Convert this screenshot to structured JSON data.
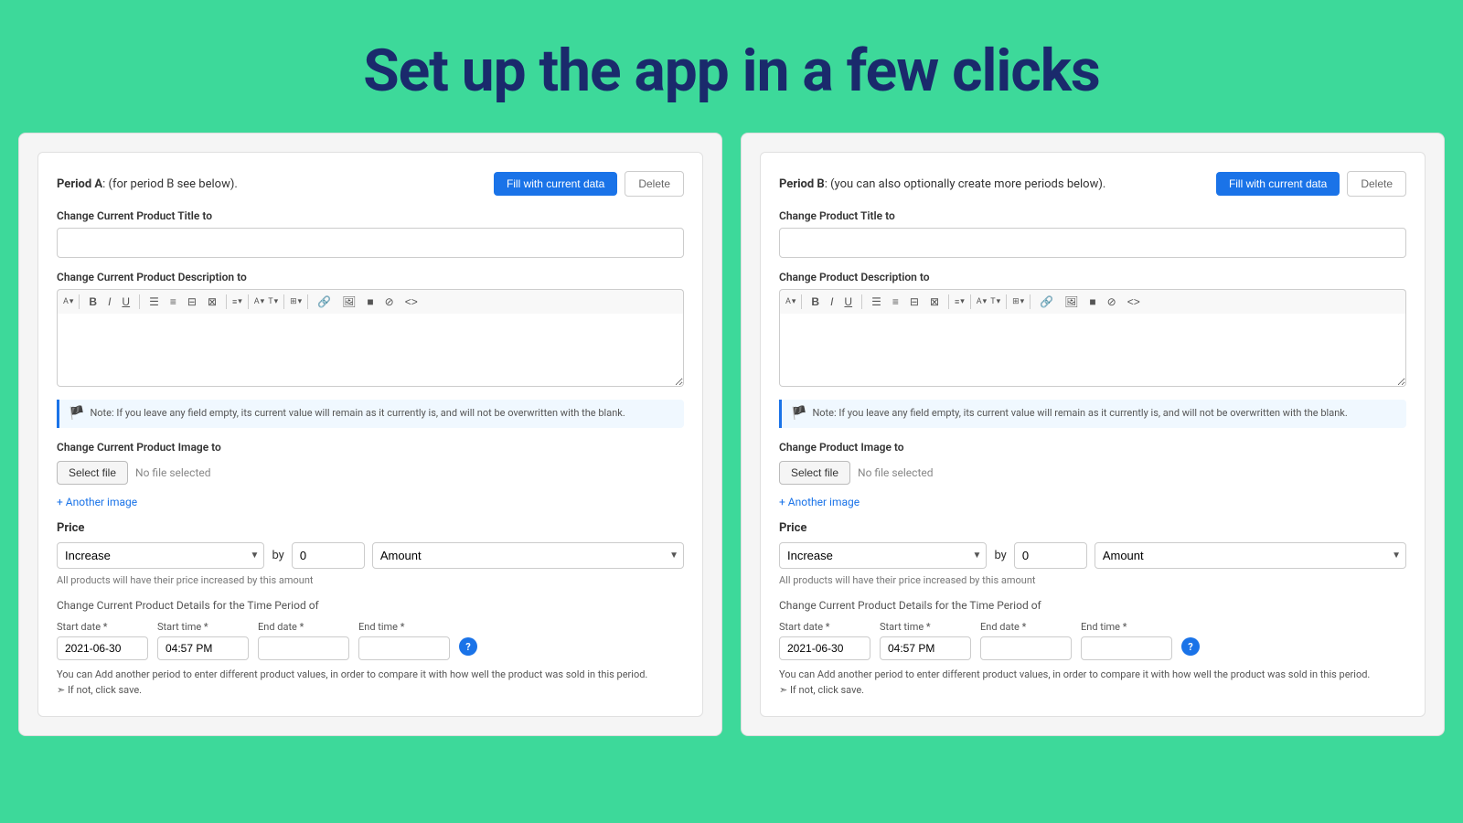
{
  "page": {
    "title": "Set up the app in a few clicks",
    "background_color": "#3dd99a"
  },
  "panel_a": {
    "period_label": "Period A",
    "period_desc": ": (for period B see below).",
    "fill_button": "Fill with current data",
    "delete_button": "Delete",
    "title_label": "Change Current Product Title to",
    "title_placeholder": "",
    "desc_label": "Change Current Product Description to",
    "desc_placeholder": "",
    "note_text": "Note: If you leave any field empty, its current value will remain as it currently is, and will not be overwritten with the blank.",
    "image_label": "Change Current Product Image to",
    "select_file_btn": "Select file",
    "no_file_text": "No file selected",
    "another_image_link": "+ Another image",
    "price_label": "Price",
    "increase_option": "Increase",
    "by_label": "by",
    "price_value": "0",
    "amount_option": "Amount",
    "price_hint": "All products will have their price increased by this amount",
    "time_period_label": "Change Current Product Details for the Time Period of",
    "start_date_label": "Start date *",
    "start_date_value": "2021-06-30",
    "start_time_label": "Start time *",
    "start_time_value": "04:57 PM",
    "end_date_label": "End date *",
    "end_date_value": "",
    "end_time_label": "End time *",
    "end_time_value": "",
    "bottom_note1": "You can Add another period to enter different product values, in order to compare it with how well the product was sold in this period.",
    "bottom_note2": "➣  If not, click save."
  },
  "panel_b": {
    "period_label": "Period B",
    "period_desc": ": (you can also optionally create more periods below).",
    "fill_button": "Fill with current data",
    "delete_button": "Delete",
    "title_label": "Change Product Title to",
    "title_placeholder": "",
    "desc_label": "Change Product Description to",
    "desc_placeholder": "",
    "note_text": "Note: If you leave any field empty, its current value will remain as it currently is, and will not be overwritten with the blank.",
    "image_label": "Change Product Image to",
    "select_file_btn": "Select file",
    "no_file_text": "No file selected",
    "another_image_link": "+ Another image",
    "price_label": "Price",
    "increase_option": "Increase",
    "by_label": "by",
    "price_value": "0",
    "amount_option": "Amount",
    "price_hint": "All products will have their price increased by this amount",
    "time_period_label": "Change Current Product Details for the Time Period of",
    "start_date_label": "Start date *",
    "start_date_value": "2021-06-30",
    "start_time_label": "Start time *",
    "start_time_value": "04:57 PM",
    "end_date_label": "End date *",
    "end_date_value": "",
    "end_time_label": "End time *",
    "end_time_value": "",
    "bottom_note1": "You can Add another period to enter different product values, in order to compare it with how well the product was sold in this period.",
    "bottom_note2": "➣  If not, click save."
  },
  "toolbar_buttons": [
    "A▾",
    "B",
    "I",
    "U",
    "≡",
    "№",
    "⊟",
    "⊠",
    "≡▾",
    "A▾",
    "T▾",
    "⊞▾",
    "🔗",
    "🖼",
    "■",
    "⊘",
    "<>"
  ]
}
